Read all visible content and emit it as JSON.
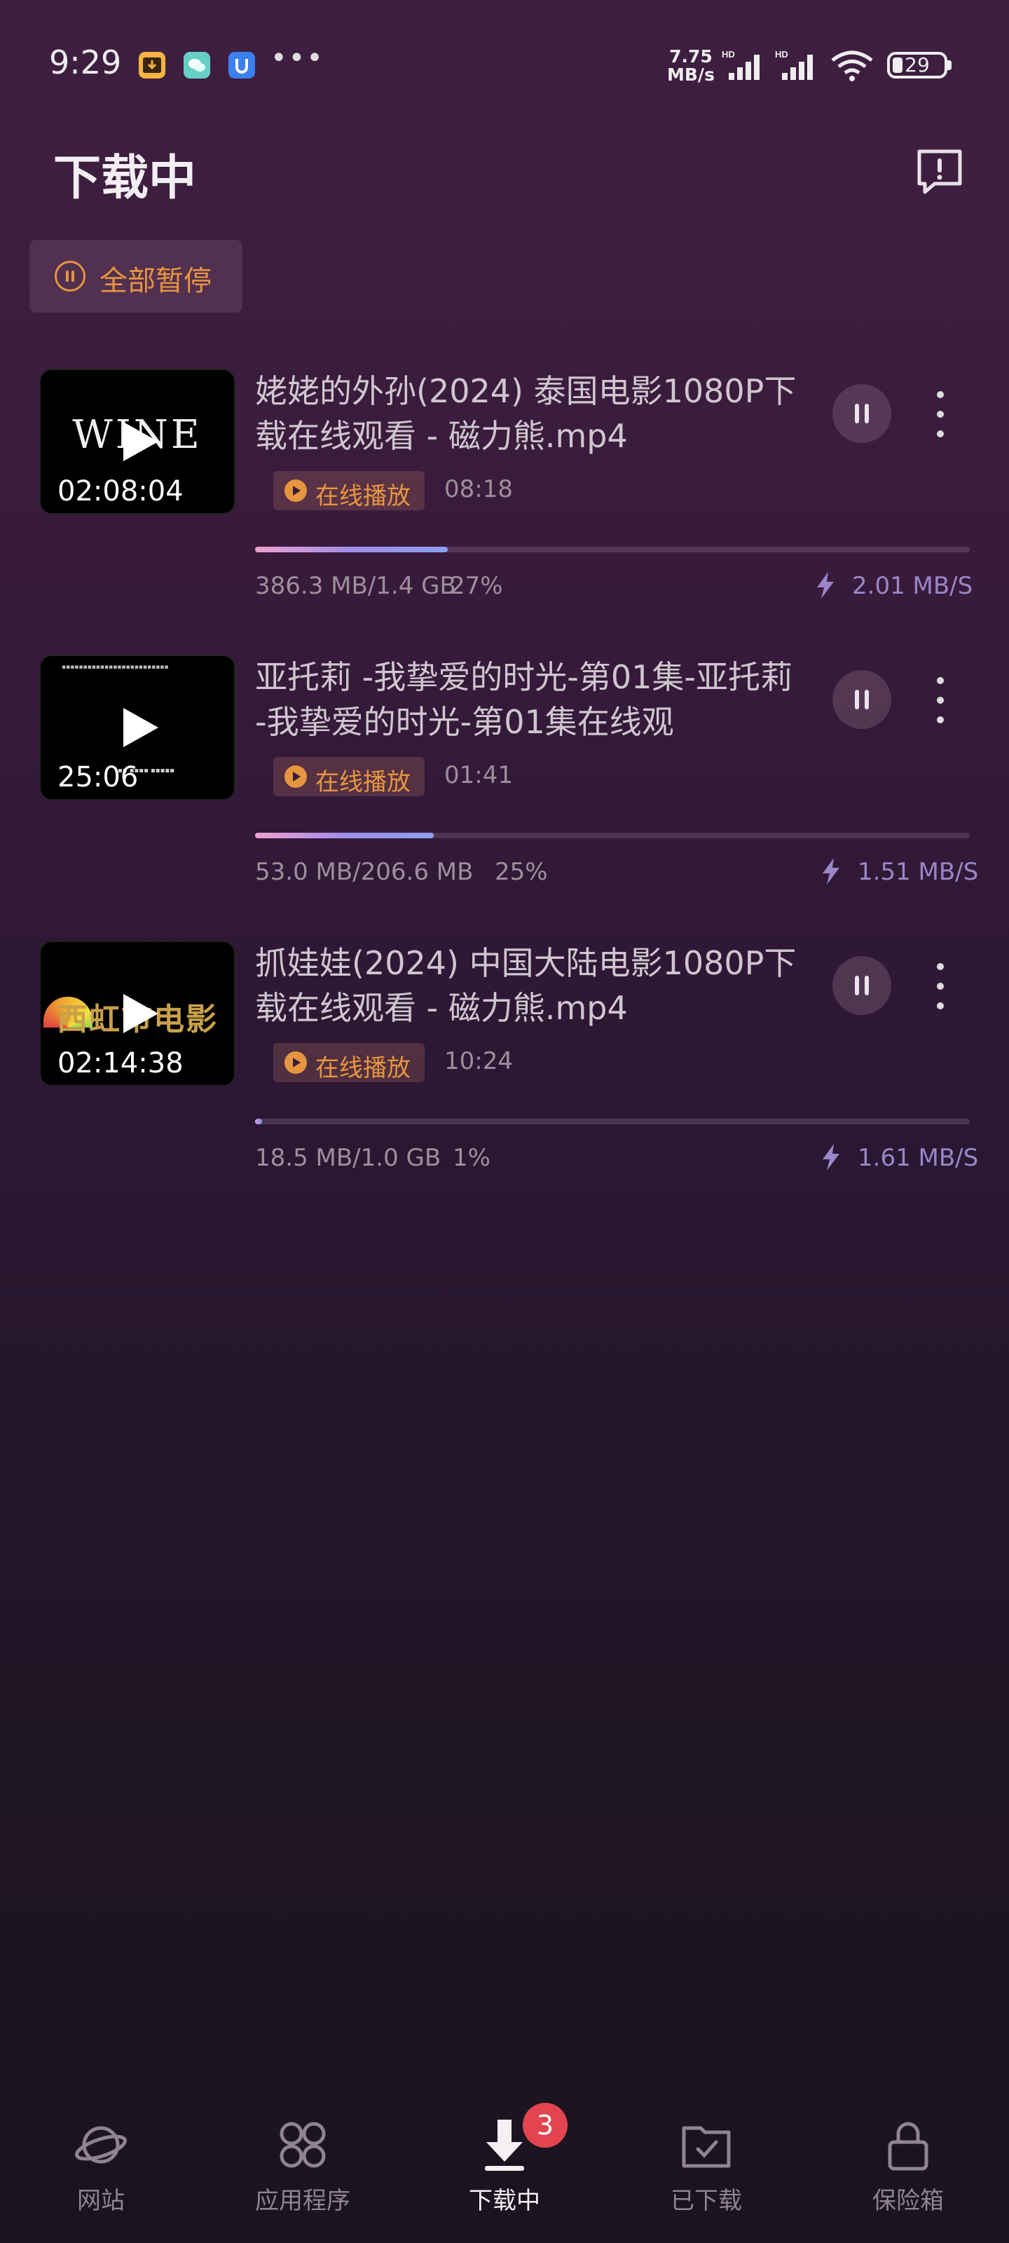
{
  "status_bar": {
    "time": "9:29",
    "net_speed_value": "7.75",
    "net_speed_unit": "MB/s",
    "battery": "29",
    "icons": [
      "download-app-icon",
      "wechat-icon",
      "u-app-icon",
      "more-dots-icon",
      "hd-signal-icon",
      "hd-signal-icon",
      "wifi-icon",
      "battery-icon"
    ]
  },
  "header": {
    "title": "下载中",
    "pause_all_label": "全部暂停",
    "feedback_icon": "feedback-icon"
  },
  "downloads": [
    {
      "title": "姥姥的外孙(2024) 泰国电影1080P下载在线观看 - 磁力熊.mp4",
      "duration": "02:08:04",
      "thumb_text": "WINE",
      "play_online_label": "在线播放",
      "play_time": "08:18",
      "size": "386.3 MB/1.4 GB",
      "percent": "27%",
      "progress": 0.27,
      "speed": "2.01 MB/S"
    },
    {
      "title": "亚托莉 -我挚爱的时光-第01集-亚托莉 -我挚爱的时光-第01集在线观",
      "duration": "25:06",
      "thumb_text": "",
      "play_online_label": "在线播放",
      "play_time": "01:41",
      "size": "53.0 MB/206.6 MB",
      "percent": "25%",
      "progress": 0.25,
      "speed": "1.51 MB/S"
    },
    {
      "title": "抓娃娃(2024) 中国大陆电影1080P下载在线观看 - 磁力熊.mp4",
      "duration": "02:14:38",
      "thumb_text": "西虹市电影",
      "play_online_label": "在线播放",
      "play_time": "10:24",
      "size": "18.5 MB/1.0 GB",
      "percent": "1%",
      "progress": 0.01,
      "speed": "1.61 MB/S"
    }
  ],
  "bottom_nav": {
    "items": [
      {
        "label": "网站",
        "icon": "planet-icon",
        "active": false
      },
      {
        "label": "应用程序",
        "icon": "apps-grid-icon",
        "active": false
      },
      {
        "label": "下载中",
        "icon": "download-arrow-icon",
        "active": true,
        "badge": "3"
      },
      {
        "label": "已下载",
        "icon": "folder-check-icon",
        "active": false
      },
      {
        "label": "保险箱",
        "icon": "lock-icon",
        "active": false
      }
    ]
  },
  "colors": {
    "accent_orange": "#e7953f",
    "speed_purple": "#9a86c8",
    "badge_red": "#e2454f"
  }
}
